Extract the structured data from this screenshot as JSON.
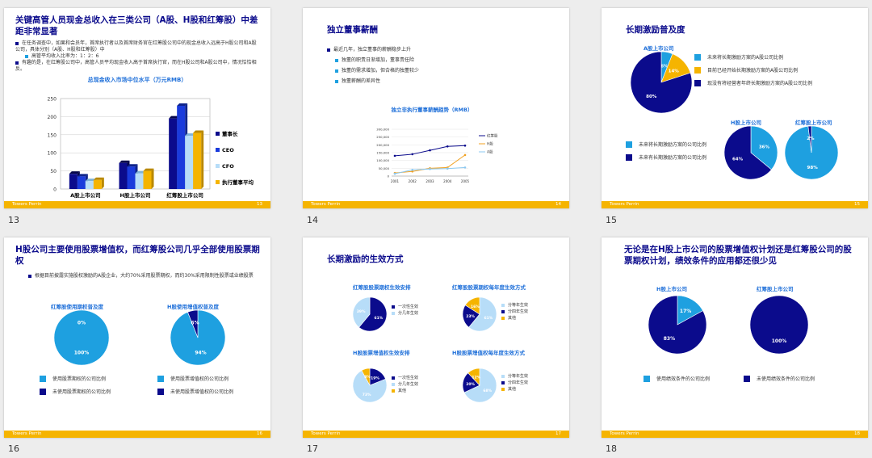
{
  "colors": {
    "navy": "#0b0b8c",
    "blue": "#1a3bdc",
    "light": "#44b4f0",
    "pale": "#b7ddf8",
    "gold": "#f5b400",
    "title": "#0b0b8c",
    "sub": "#1e6fd9"
  },
  "footer": {
    "brand": "Towers Perrin"
  },
  "slides": [
    {
      "num": "13",
      "title": "关键高管人员现金总收入在三类公司（A股、H股和红筹股）中差距非常显著",
      "bullets": [
        "在任务调查中，如果和会员年，首席执行者以及首席财务官在红筹股公司中的现金总收入远高于H股公司和A股公司，具体分别（A股、H股和红筹股）中",
        "高管平均收入比率为：1：2：6",
        "有趣的是，在红筹股公司中，高管人员平均现金收入高于首席执行官，而在H股公司和A股公司中，情况恰恰相反。"
      ],
      "chart_data": {
        "type": "bar",
        "title": "总现金收入市场中位水平（万元RMB）",
        "categories": [
          "A股上市公司",
          "H股上市公司",
          "红筹股上市公司"
        ],
        "series": [
          {
            "name": "董事长",
            "values": [
              42,
              72,
              195
            ]
          },
          {
            "name": "CEO",
            "values": [
              35,
              62,
              230
            ]
          },
          {
            "name": "CFO",
            "values": [
              22,
              43,
              147
            ]
          },
          {
            "name": "执行董事平均",
            "values": [
              25,
              50,
              155
            ]
          }
        ],
        "ylim": [
          0,
          250
        ],
        "yticks": [
          "0",
          "50",
          "100",
          "150",
          "200",
          "250"
        ]
      },
      "pnum": "13"
    },
    {
      "num": "14",
      "title": "独立董事薪酬",
      "bullets": [
        "最近几年，独立董事的薪酬稳步上升",
        "独董的职责日渐增加，董事责任险",
        "独董的需求增加，但合格的独董较少",
        "独董薪酬的差异性"
      ],
      "chart_data": {
        "type": "line",
        "title": "独立非执行董事薪酬趋势（RMB）",
        "categories": [
          "2001",
          "2002",
          "2003",
          "2004",
          "2005"
        ],
        "series": [
          {
            "name": "红筹股",
            "values": [
              130000,
              140000,
              165000,
              190000,
              195000
            ]
          },
          {
            "name": "H股",
            "values": [
              20000,
              30000,
              50000,
              55000,
              135000
            ]
          },
          {
            "name": "A股",
            "values": [
              15000,
              40000,
              45000,
              48000,
              55000
            ]
          }
        ],
        "ylim": [
          0,
          300000
        ],
        "yticks": [
          "0",
          "50,000",
          "100,000",
          "150,000",
          "200,000",
          "250,000",
          "300,000"
        ]
      },
      "pnum": "14"
    },
    {
      "num": "15",
      "title": "长期激励普及度",
      "sub_a": "A股上市公司",
      "sub_h": "H股上市公司",
      "sub_r": "红筹股上市公司",
      "legend_a": [
        "未来将长期激励方案的A股公司比例",
        "目前已经开始长期激励方案的A股公司比例",
        "现没有将经营者年终长期激励方案的A股公司比例"
      ],
      "legend_b": [
        "未来将长期激励方案的公司比例",
        "未来有长期激励方案的公司比例"
      ],
      "chart_data": [
        {
          "type": "pie",
          "title": "A股上市公司",
          "values": [
            6,
            14,
            80
          ],
          "labels": [
            "6%",
            "14%",
            "80%"
          ]
        },
        {
          "type": "pie",
          "title": "H股上市公司",
          "values": [
            36,
            64
          ],
          "labels": [
            "36%",
            "64%"
          ]
        },
        {
          "type": "pie",
          "title": "红筹股上市公司",
          "values": [
            98,
            2
          ],
          "labels": [
            "98%",
            "2%"
          ]
        }
      ],
      "pnum": "15"
    },
    {
      "num": "16",
      "title": "H股公司主要使用股票增值权，而红筹股公司几乎全部使用股票期权",
      "bullets": [
        "根据目前披露实施股权激励的A股企业，大约70%采用股票期权，而约30%采用限制性股票或业绩股票"
      ],
      "sub_l": "红筹股使用期权普及度",
      "sub_r": "H股使用增值权普及度",
      "legend_l": [
        "使用股票期权的公司比例",
        "未使用股票期权的公司比例"
      ],
      "legend_r": [
        "使用股票增值权的公司比例",
        "未使用股票增值权的公司比例"
      ],
      "chart_data": [
        {
          "type": "pie",
          "title": "红筹股使用期权普及度",
          "values": [
            100,
            0
          ],
          "labels": [
            "100%",
            "0%"
          ]
        },
        {
          "type": "pie",
          "title": "H股使用增值权普及度",
          "values": [
            94,
            6
          ],
          "labels": [
            "94%",
            "6%"
          ]
        }
      ],
      "pnum": "16"
    },
    {
      "num": "17",
      "title": "长期激励的生效方式",
      "sub_tl": "红筹股股票期权生效安排",
      "sub_tr": "红筹股股票期权每年度生效方式",
      "sub_bl": "H股股票增值权生效安排",
      "sub_br": "H股股票增值权每年度生效方式",
      "leg_tl": [
        "一次性生效",
        "分几年生效"
      ],
      "leg_tr": [
        "分等年生效",
        "分四年生效",
        "其他"
      ],
      "leg_bl": [
        "一次性生效",
        "分几年生效",
        "其他"
      ],
      "leg_br": [
        "分等年生效",
        "分四年生效",
        "其他"
      ],
      "chart_data": [
        {
          "type": "pie",
          "values": [
            61,
            39
          ],
          "labels": [
            "61%",
            "39%"
          ]
        },
        {
          "type": "pie",
          "values": [
            61,
            23,
            16
          ],
          "labels": [
            "61%",
            "23%",
            "16%"
          ]
        },
        {
          "type": "pie",
          "values": [
            19,
            73,
            8
          ],
          "labels": [
            "19%",
            "73%",
            "8%"
          ]
        },
        {
          "type": "pie",
          "values": [
            68,
            20,
            12
          ],
          "labels": [
            "68%",
            "20%",
            "12%"
          ]
        }
      ],
      "pnum": "17"
    },
    {
      "num": "18",
      "title": "无论是在H股上市公司的股票增值权计划还是红筹股公司的股票期权计划，绩效条件的应用都还很少见",
      "sub_l": "H股上市公司",
      "sub_r": "红筹股上市公司",
      "legend": [
        "使用绩效条件的公司比例",
        "未使用绩效条件的公司比例"
      ],
      "chart_data": [
        {
          "type": "pie",
          "title": "H股上市公司",
          "values": [
            17,
            83
          ],
          "labels": [
            "17%",
            "83%"
          ]
        },
        {
          "type": "pie",
          "title": "红筹股上市公司",
          "values": [
            0,
            100
          ],
          "labels": [
            "0%",
            "100%"
          ]
        }
      ],
      "pnum": "18"
    }
  ]
}
